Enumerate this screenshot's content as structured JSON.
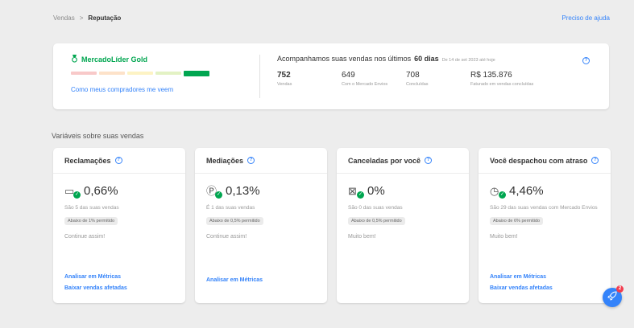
{
  "breadcrumb": {
    "parent": "Vendas",
    "separator": ">",
    "current": "Reputação"
  },
  "help_link": "Preciso de ajuda",
  "reputation": {
    "level": "MercadoLíder Gold",
    "level_color": "#00a650",
    "thermometer_colors": [
      "#f8c9c9",
      "#fde2c9",
      "#fdf3c4",
      "#e3f2c4",
      "#00a650"
    ],
    "thermometer_active_index": 4,
    "how_link": "Como meus compradores me veem",
    "title_prefix": "Acompanhamos suas vendas nos últimos",
    "title_period": "60 dias",
    "since": "De 14 de set 2023 até hoje",
    "stats": [
      {
        "value": "752",
        "label": "Vendas"
      },
      {
        "value": "649",
        "label": "Com o Mercado Envios"
      },
      {
        "value": "708",
        "label": "Concluídas"
      },
      {
        "value": "R$ 135.876",
        "label": "Faturado em vendas concluídas"
      }
    ]
  },
  "section_title": "Variáveis sobre suas vendas",
  "cards": [
    {
      "title": "Reclamações",
      "icon": "complaint-icon",
      "value": "0,66%",
      "sub": "São 5 das suas vendas",
      "pill": "Abaixo de 1% permitido",
      "note": "Continue assim!",
      "links": [
        "Analisar em Métricas",
        "Baixar vendas afetadas"
      ]
    },
    {
      "title": "Mediações",
      "icon": "mediation-icon",
      "value": "0,13%",
      "sub": "É 1 das suas vendas",
      "pill": "Abaixo de 0,5% permitido",
      "note": "Continue assim!",
      "links": [
        "Analisar em Métricas"
      ]
    },
    {
      "title": "Canceladas por você",
      "icon": "cancelled-icon",
      "value": "0%",
      "sub": "São 0 das suas vendas",
      "pill": "Abaixo de 0,5% permitido",
      "note": "Muito bem!",
      "links": []
    },
    {
      "title": "Você despachou com atraso",
      "icon": "late-dispatch-icon",
      "value": "4,46%",
      "sub": "São 29 das suas vendas com Mercado Envios",
      "pill": "Abaixo de 6% permitido",
      "note": "Muito bem!",
      "links": [
        "Analisar em Métricas",
        "Baixar vendas afetadas"
      ]
    }
  ],
  "fab": {
    "icon": "rocket-icon",
    "badge": "2"
  },
  "colors": {
    "link": "#3483fa",
    "success": "#00a650",
    "badge": "#f23d4f",
    "background": "#ededed"
  }
}
